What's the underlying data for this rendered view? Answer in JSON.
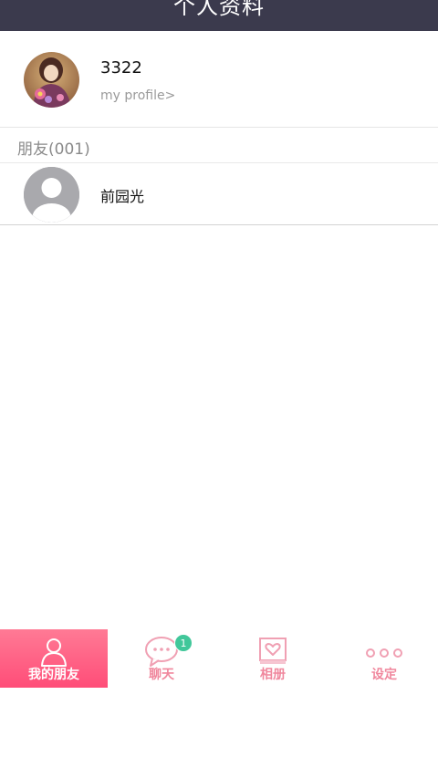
{
  "header": {
    "title": "个人资料"
  },
  "profile": {
    "username": "3322",
    "subtitle": "my profile>"
  },
  "friends": {
    "section_label": "朋友(001)",
    "items": [
      {
        "name": "前园光"
      }
    ]
  },
  "tabbar": {
    "tabs": [
      {
        "label": "我的朋友",
        "icon": "person-icon",
        "active": true
      },
      {
        "label": "聊天",
        "icon": "chat-bubble-icon",
        "badge": "1"
      },
      {
        "label": "相册",
        "icon": "photo-heart-icon"
      },
      {
        "label": "设定",
        "icon": "more-dots-icon"
      }
    ]
  },
  "colors": {
    "header_bg": "#3b3a4d",
    "accent": "#ff5c80",
    "badge": "#41c79a",
    "tab_label": "#f0879d"
  }
}
